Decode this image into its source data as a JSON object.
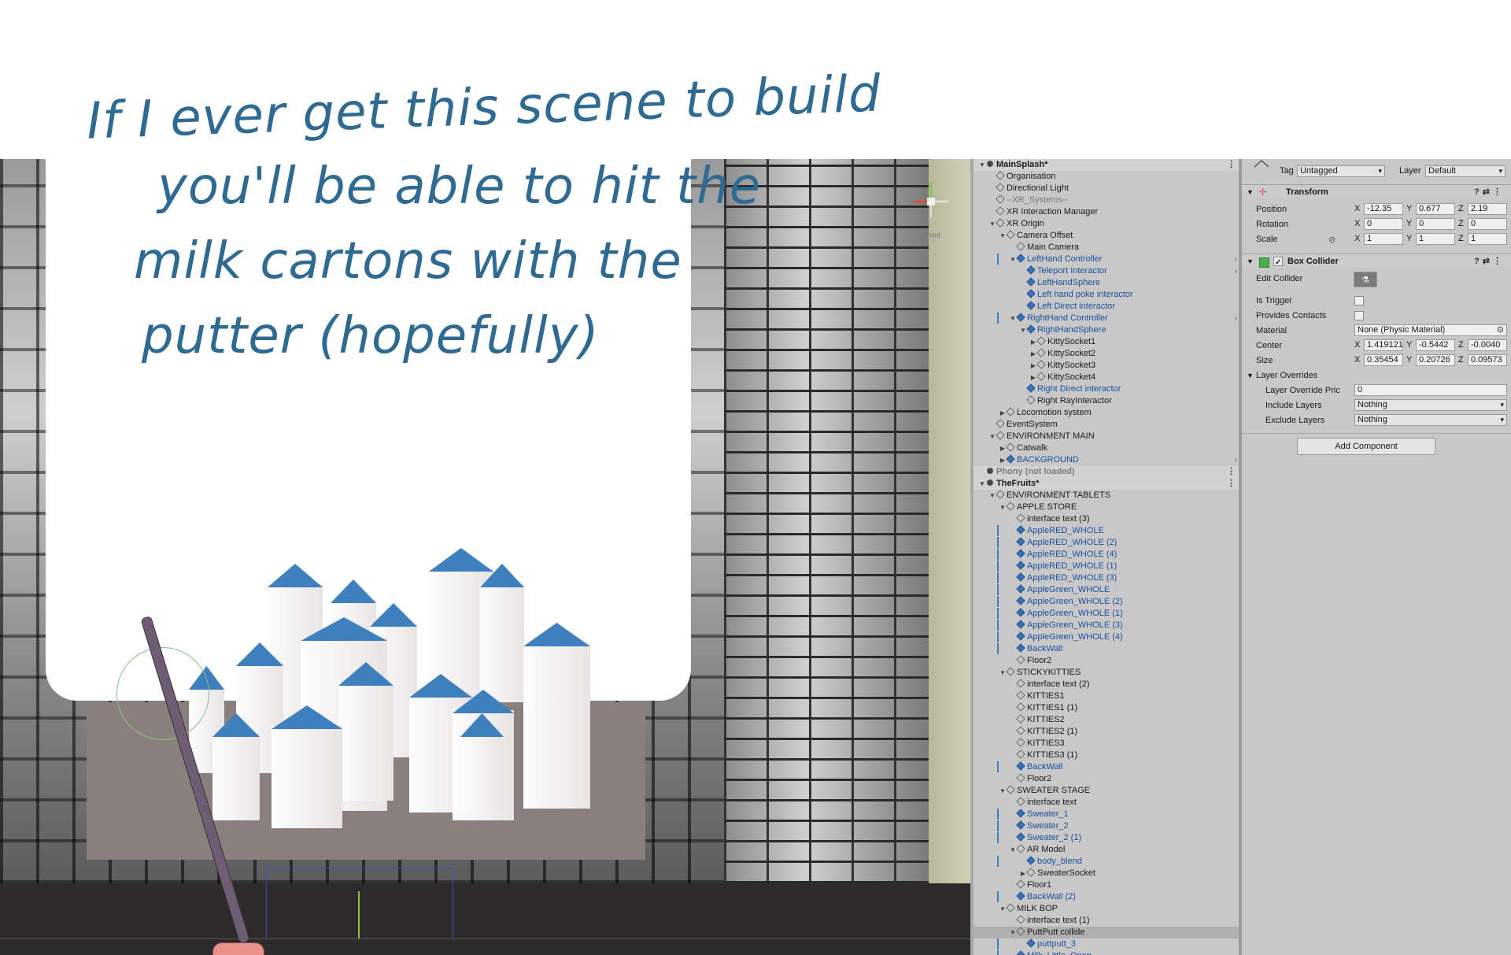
{
  "note": {
    "lines": [
      "If I ever get this scene to build",
      "you'll be able to hit the",
      "milk cartons with the",
      "putter (hopefully)"
    ],
    "color": "#2f6a93"
  },
  "scene_view": {
    "gizmo_label": "Front"
  },
  "hierarchy": {
    "rows": [
      {
        "label": "MainSplash*",
        "depth": 0,
        "arrow": "down",
        "icon": "unity-scene-icon",
        "type": "scene",
        "kebab": true
      },
      {
        "label": "Organisation",
        "depth": 1,
        "arrow": "",
        "icon": "cube-icon"
      },
      {
        "label": "Directional Light",
        "depth": 1,
        "arrow": "",
        "icon": "cube-icon"
      },
      {
        "label": "--XR_Systems--",
        "depth": 1,
        "arrow": "",
        "icon": "cube-icon",
        "type": "disabled"
      },
      {
        "label": "XR Interaction Manager",
        "depth": 1,
        "arrow": "",
        "icon": "cube-icon"
      },
      {
        "label": "XR Origin",
        "depth": 1,
        "arrow": "down",
        "icon": "cube-icon"
      },
      {
        "label": "Camera Offset",
        "depth": 2,
        "arrow": "down",
        "icon": "cube-icon"
      },
      {
        "label": "Main Camera",
        "depth": 3,
        "arrow": "",
        "icon": "cube-icon"
      },
      {
        "label": "LeftHand Controller",
        "depth": 3,
        "arrow": "down",
        "icon": "prefab-cube-icon",
        "type": "prefab",
        "more": true,
        "bar": true
      },
      {
        "label": "Teleport Interactor",
        "depth": 4,
        "arrow": "",
        "icon": "prefab-cube-icon",
        "type": "prefab",
        "more": true
      },
      {
        "label": "LeftHandSphere",
        "depth": 4,
        "arrow": "",
        "icon": "prefab-cube-icon",
        "type": "prefab"
      },
      {
        "label": "Left hand poke interactor",
        "depth": 4,
        "arrow": "",
        "icon": "prefab-cube-icon",
        "type": "prefab"
      },
      {
        "label": "Left Direct interactor",
        "depth": 4,
        "arrow": "",
        "icon": "prefab-cube-icon",
        "type": "prefab"
      },
      {
        "label": "RightHand Controller",
        "depth": 3,
        "arrow": "down",
        "icon": "prefab-cube-icon",
        "type": "prefab",
        "more": true,
        "bar": true
      },
      {
        "label": "RightHandSphere",
        "depth": 4,
        "arrow": "down",
        "icon": "prefab-cube-icon",
        "type": "prefab"
      },
      {
        "label": "KittySocket1",
        "depth": 5,
        "arrow": "right",
        "icon": "cube-icon"
      },
      {
        "label": "KittySocket2",
        "depth": 5,
        "arrow": "right",
        "icon": "cube-icon"
      },
      {
        "label": "KittySocket3",
        "depth": 5,
        "arrow": "right",
        "icon": "cube-icon"
      },
      {
        "label": "KittySocket4",
        "depth": 5,
        "arrow": "right",
        "icon": "cube-icon"
      },
      {
        "label": "Right Direct interactor",
        "depth": 4,
        "arrow": "",
        "icon": "prefab-cube-icon",
        "type": "prefab"
      },
      {
        "label": "Right RayInteractor",
        "depth": 4,
        "arrow": "",
        "icon": "cube-icon"
      },
      {
        "label": "Locomotion system",
        "depth": 2,
        "arrow": "right",
        "icon": "cube-icon"
      },
      {
        "label": "EventSystem",
        "depth": 1,
        "arrow": "",
        "icon": "cube-icon"
      },
      {
        "label": "ENVIRONMENT MAIN",
        "depth": 1,
        "arrow": "down",
        "icon": "cube-icon"
      },
      {
        "label": "Catwalk",
        "depth": 2,
        "arrow": "right",
        "icon": "cube-icon"
      },
      {
        "label": "BACKGROUND",
        "depth": 2,
        "arrow": "right",
        "icon": "prefab-cube-icon",
        "type": "prefab",
        "more": true
      },
      {
        "label": "Phony (not loaded)",
        "depth": 0,
        "arrow": "",
        "icon": "unity-scene-icon",
        "type": "disabled",
        "kebab": true,
        "hdr": true
      },
      {
        "label": "TheFruits*",
        "depth": 0,
        "arrow": "down",
        "icon": "unity-scene-icon",
        "type": "scene",
        "kebab": true
      },
      {
        "label": "ENVIRONMENT TABLETS",
        "depth": 1,
        "arrow": "down",
        "icon": "cube-icon"
      },
      {
        "label": "APPLE STORE",
        "depth": 2,
        "arrow": "down",
        "icon": "cube-icon"
      },
      {
        "label": "interface text (3)",
        "depth": 3,
        "arrow": "",
        "icon": "cube-icon"
      },
      {
        "label": "AppleRED_WHOLE",
        "depth": 3,
        "arrow": "",
        "icon": "prefab-cube-icon",
        "type": "prefab",
        "bar": true
      },
      {
        "label": "AppleRED_WHOLE (2)",
        "depth": 3,
        "arrow": "",
        "icon": "prefab-cube-icon",
        "type": "prefab",
        "bar": true
      },
      {
        "label": "AppleRED_WHOLE (4)",
        "depth": 3,
        "arrow": "",
        "icon": "prefab-cube-icon",
        "type": "prefab",
        "bar": true
      },
      {
        "label": "AppleRED_WHOLE (1)",
        "depth": 3,
        "arrow": "",
        "icon": "prefab-cube-icon",
        "type": "prefab",
        "bar": true
      },
      {
        "label": "AppleRED_WHOLE (3)",
        "depth": 3,
        "arrow": "",
        "icon": "prefab-cube-icon",
        "type": "prefab",
        "bar": true
      },
      {
        "label": "AppleGreen_WHOLE",
        "depth": 3,
        "arrow": "",
        "icon": "prefab-cube-icon",
        "type": "prefab",
        "bar": true
      },
      {
        "label": "AppleGreen_WHOLE (2)",
        "depth": 3,
        "arrow": "",
        "icon": "prefab-cube-icon",
        "type": "prefab",
        "bar": true
      },
      {
        "label": "AppleGreen_WHOLE (1)",
        "depth": 3,
        "arrow": "",
        "icon": "prefab-cube-icon",
        "type": "prefab",
        "bar": true
      },
      {
        "label": "AppleGreen_WHOLE (3)",
        "depth": 3,
        "arrow": "",
        "icon": "prefab-cube-icon",
        "type": "prefab",
        "bar": true
      },
      {
        "label": "AppleGreen_WHOLE (4)",
        "depth": 3,
        "arrow": "",
        "icon": "prefab-cube-icon",
        "type": "prefab",
        "bar": true
      },
      {
        "label": "BackWall",
        "depth": 3,
        "arrow": "",
        "icon": "prefab-cube-icon",
        "type": "prefab",
        "bar": true
      },
      {
        "label": "Floor2",
        "depth": 3,
        "arrow": "",
        "icon": "cube-icon"
      },
      {
        "label": "STICKYKITTIES",
        "depth": 2,
        "arrow": "down",
        "icon": "cube-icon"
      },
      {
        "label": "interface text (2)",
        "depth": 3,
        "arrow": "",
        "icon": "cube-icon"
      },
      {
        "label": "KITTIES1",
        "depth": 3,
        "arrow": "",
        "icon": "cube-icon"
      },
      {
        "label": "KITTIES1 (1)",
        "depth": 3,
        "arrow": "",
        "icon": "cube-icon"
      },
      {
        "label": "KITTIES2",
        "depth": 3,
        "arrow": "",
        "icon": "cube-icon"
      },
      {
        "label": "KITTIES2 (1)",
        "depth": 3,
        "arrow": "",
        "icon": "cube-icon"
      },
      {
        "label": "KITTIES3",
        "depth": 3,
        "arrow": "",
        "icon": "cube-icon"
      },
      {
        "label": "KITTIES3 (1)",
        "depth": 3,
        "arrow": "",
        "icon": "cube-icon"
      },
      {
        "label": "BackWall",
        "depth": 3,
        "arrow": "",
        "icon": "prefab-cube-icon",
        "type": "prefab",
        "bar": true
      },
      {
        "label": "Floor2",
        "depth": 3,
        "arrow": "",
        "icon": "cube-icon"
      },
      {
        "label": "SWEATER STAGE",
        "depth": 2,
        "arrow": "down",
        "icon": "cube-icon"
      },
      {
        "label": "interface text",
        "depth": 3,
        "arrow": "",
        "icon": "cube-icon"
      },
      {
        "label": "Sweater_1",
        "depth": 3,
        "arrow": "",
        "icon": "prefab-cube-icon",
        "type": "prefab",
        "bar": true
      },
      {
        "label": "Sweater_2",
        "depth": 3,
        "arrow": "",
        "icon": "prefab-cube-icon",
        "type": "prefab",
        "bar": true
      },
      {
        "label": "Sweater_2 (1)",
        "depth": 3,
        "arrow": "",
        "icon": "prefab-cube-icon",
        "type": "prefab",
        "bar": true
      },
      {
        "label": "AR Model",
        "depth": 3,
        "arrow": "down",
        "icon": "cube-icon"
      },
      {
        "label": "body_blend",
        "depth": 4,
        "arrow": "",
        "icon": "prefab-cube-icon",
        "type": "prefab",
        "bar": true
      },
      {
        "label": "SweaterSocket",
        "depth": 4,
        "arrow": "right",
        "icon": "cube-icon"
      },
      {
        "label": "Floor1",
        "depth": 3,
        "arrow": "",
        "icon": "cube-icon"
      },
      {
        "label": "BackWall (2)",
        "depth": 3,
        "arrow": "",
        "icon": "prefab-cube-icon",
        "type": "prefab",
        "bar": true
      },
      {
        "label": "MILK BOP",
        "depth": 2,
        "arrow": "down",
        "icon": "cube-icon"
      },
      {
        "label": "interface text (1)",
        "depth": 3,
        "arrow": "",
        "icon": "cube-icon"
      },
      {
        "label": "PuttPutt collide",
        "depth": 3,
        "arrow": "down",
        "icon": "cube-icon",
        "type": "sel"
      },
      {
        "label": "puttputt_3",
        "depth": 4,
        "arrow": "",
        "icon": "prefab-cube-icon",
        "type": "prefab",
        "bar": true
      },
      {
        "label": "Milk_Little_Open",
        "depth": 3,
        "arrow": "",
        "icon": "prefab-cube-icon",
        "type": "prefab",
        "bar": true
      }
    ]
  },
  "inspector": {
    "tag_label": "Tag",
    "tag_value": "Untagged",
    "layer_label": "Layer",
    "layer_value": "Default",
    "transform": {
      "title": "Transform",
      "position_label": "Position",
      "rotation_label": "Rotation",
      "scale_label": "Scale",
      "axis_x": "X",
      "axis_y": "Y",
      "axis_z": "Z",
      "position": [
        "-12.35",
        "0.677",
        "2.19"
      ],
      "rotation": [
        "0",
        "0",
        "0"
      ],
      "scale": [
        "1",
        "1",
        "1"
      ]
    },
    "box_collider": {
      "title": "Box Collider",
      "edit_collider_label": "Edit Collider",
      "is_trigger_label": "Is Trigger",
      "provides_contacts_label": "Provides Contacts",
      "material_label": "Material",
      "material_value": "None (Physic Material)",
      "center_label": "Center",
      "center": [
        "1.419121",
        "-0.5442",
        "-0.0040"
      ],
      "size_label": "Size",
      "size": [
        "0.35454",
        "0.20726",
        "0.09573"
      ],
      "layer_overrides_label": "Layer Overrides",
      "layer_override_priority_label": "Layer Override Pric",
      "layer_override_priority_value": "0",
      "include_layers_label": "Include Layers",
      "include_layers_value": "Nothing",
      "exclude_layers_label": "Exclude Layers",
      "exclude_layers_value": "Nothing"
    },
    "add_component_label": "Add Component"
  }
}
